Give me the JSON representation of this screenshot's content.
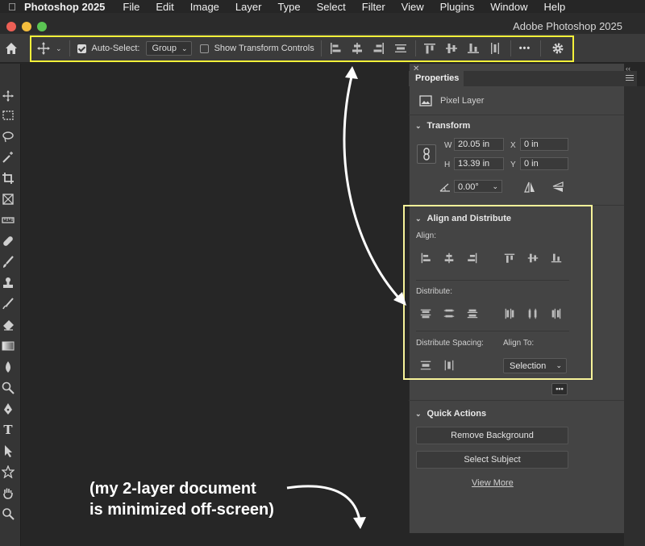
{
  "menubar": {
    "app": "Photoshop 2025",
    "items": [
      "File",
      "Edit",
      "Image",
      "Layer",
      "Type",
      "Select",
      "Filter",
      "View",
      "Plugins",
      "Window",
      "Help"
    ]
  },
  "window": {
    "title": "Adobe Photoshop 2025"
  },
  "options": {
    "auto_select_label": "Auto-Select:",
    "auto_select_value": "Group",
    "show_transform_label": "Show Transform Controls",
    "more_label": "•••"
  },
  "properties": {
    "tab": "Properties",
    "layer_type": "Pixel Layer",
    "transform": {
      "header": "Transform",
      "w_label": "W",
      "w_value": "20.05 in",
      "h_label": "H",
      "h_value": "13.39 in",
      "x_label": "X",
      "x_value": "0 in",
      "y_label": "Y",
      "y_value": "0 in",
      "angle_value": "0.00°"
    },
    "align": {
      "header": "Align and Distribute",
      "align_label": "Align:",
      "distribute_label": "Distribute:",
      "spacing_label": "Distribute Spacing:",
      "align_to_label": "Align To:",
      "align_to_value": "Selection"
    },
    "more_label": "•••",
    "quick": {
      "header": "Quick Actions",
      "remove_bg": "Remove Background",
      "select_subject": "Select Subject",
      "view_more": "View More"
    }
  },
  "annotation": {
    "line1": "(my 2-layer document",
    "line2": "is minimized off-screen)"
  },
  "colors": {
    "highlight_toolbar": "#f4f13a",
    "highlight_panel": "#f7f39a",
    "canvas_bg": "#262626",
    "panel_bg": "#444444"
  }
}
